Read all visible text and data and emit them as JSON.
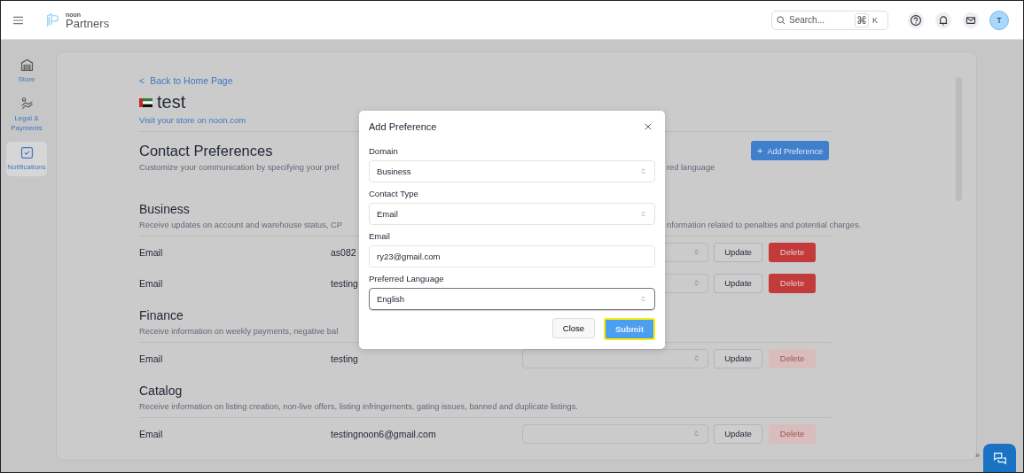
{
  "header": {
    "logo_small": "noon",
    "logo_main": "Partners",
    "search": {
      "placeholder": "Search...",
      "shortcut_symbol": "⌘",
      "shortcut_key": "K"
    },
    "avatar": "T"
  },
  "sidebar": {
    "items": [
      {
        "label": "Store",
        "selected": false
      },
      {
        "label": "Legal & Payments",
        "selected": false
      },
      {
        "label": "Notifications",
        "selected": true
      }
    ]
  },
  "page": {
    "back_link": "Back to Home Page",
    "back_symbol": "<",
    "store_name": "test",
    "visit_link": "Visit your store on noon.com",
    "title": "Contact Preferences",
    "description_left": "Customize your communication by specifying your pref",
    "description_right": "red language",
    "add_button": "Add Preference",
    "add_symbol": "+"
  },
  "sections": [
    {
      "title": "Business",
      "description_left": "Receive updates on account and warehouse status, CP",
      "description_right": "nformation related to penalties and potential charges.",
      "rows": [
        {
          "type": "Email",
          "value": "as082",
          "update": "Update",
          "delete": "Delete",
          "disabled": false
        },
        {
          "type": "Email",
          "value": "testing",
          "update": "Update",
          "delete": "Delete",
          "disabled": false
        }
      ]
    },
    {
      "title": "Finance",
      "description_left": "Receive information on weekly payments, negative bal",
      "rows": [
        {
          "type": "Email",
          "value": "testing",
          "update": "Update",
          "delete": "Delete",
          "disabled": true
        }
      ]
    },
    {
      "title": "Catalog",
      "description_left": "Receive information on listing creation, non-live offers, listing infringements, gating issues, banned and duplicate listings.",
      "rows": [
        {
          "type": "Email",
          "value": "testingnoon6@gmail.com",
          "update": "Update",
          "delete": "Delete",
          "disabled": true
        }
      ]
    }
  ],
  "modal": {
    "title": "Add Preference",
    "fields": [
      {
        "label": "Domain",
        "kind": "select",
        "value": "Business",
        "focused": false
      },
      {
        "label": "Contact Type",
        "kind": "select",
        "value": "Email",
        "focused": false
      },
      {
        "label": "Email",
        "kind": "input",
        "value": "ry23@gmail.com",
        "focused": false
      },
      {
        "label": "Preferred Language",
        "kind": "select",
        "value": "English",
        "focused": true
      }
    ],
    "close_button": "Close",
    "submit_button": "Submit"
  },
  "chat": {
    "collapse_symbol": "»"
  }
}
